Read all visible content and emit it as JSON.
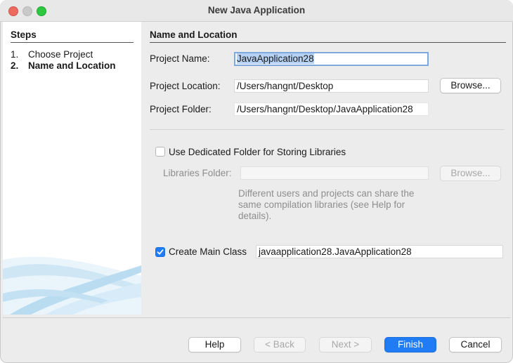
{
  "window": {
    "title": "New Java Application"
  },
  "steps": {
    "header": "Steps",
    "items": [
      {
        "num": "1.",
        "label": "Choose Project"
      },
      {
        "num": "2.",
        "label": "Name and Location"
      }
    ]
  },
  "section": {
    "header": "Name and Location"
  },
  "project_name": {
    "label": "Project Name:",
    "value": "JavaApplication28"
  },
  "project_location": {
    "label": "Project Location:",
    "value": "/Users/hangnt/Desktop",
    "browse": "Browse..."
  },
  "project_folder": {
    "label": "Project Folder:",
    "value": "/Users/hangnt/Desktop/JavaApplication28"
  },
  "dedicated_folder": {
    "label": "Use Dedicated Folder for Storing Libraries",
    "checked": false
  },
  "libraries_folder": {
    "label": "Libraries Folder:",
    "value": "",
    "browse": "Browse...",
    "hint_lines": [
      "Different users and projects can share the",
      "same compilation libraries (see Help for",
      "details)."
    ]
  },
  "main_class": {
    "label": "Create Main Class",
    "checked": true,
    "value": "javaapplication28.JavaApplication28"
  },
  "buttons": {
    "help": "Help",
    "back": "< Back",
    "next": "Next >",
    "finish": "Finish",
    "cancel": "Cancel"
  },
  "colors": {
    "accent": "#1f7cf5",
    "selection": "#b5d2f5",
    "focus_ring": "#7fa9dc"
  }
}
